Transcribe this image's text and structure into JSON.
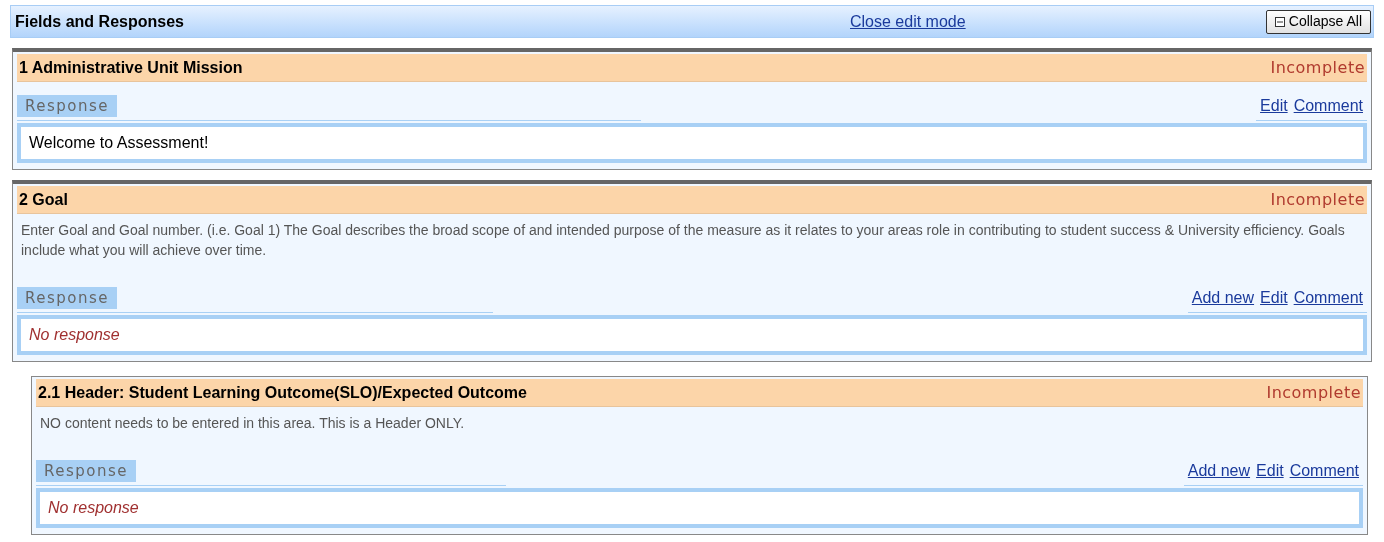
{
  "header": {
    "title": "Fields and Responses",
    "link": "Close edit mode",
    "button": "Collapse All"
  },
  "sections": [
    {
      "title": "1 Administrative Unit Mission",
      "status": "Incomplete",
      "response_label": "Response",
      "actions": [
        "Edit",
        "Comment"
      ],
      "response": {
        "kind": "answer",
        "text": "Welcome to Assessment!"
      }
    },
    {
      "title": "2 Goal",
      "status": "Incomplete",
      "description": "Enter Goal and Goal number. (i.e. Goal 1) The Goal describes the broad scope of and intended purpose of the measure as it relates to your areas role in contributing to student success & University efficiency. Goals include what you will achieve over time.",
      "response_label": "Response",
      "actions": [
        "Add new",
        "Edit",
        "Comment"
      ],
      "response": {
        "kind": "none",
        "text": "No response"
      },
      "children": [
        {
          "title": "2.1 Header: Student Learning Outcome(SLO)/Expected Outcome",
          "status": "Incomplete",
          "description": "NO content needs to be entered in this area. This is a Header ONLY.",
          "response_label": "Response",
          "actions": [
            "Add new",
            "Edit",
            "Comment"
          ],
          "response": {
            "kind": "none",
            "text": "No response"
          }
        }
      ]
    }
  ]
}
